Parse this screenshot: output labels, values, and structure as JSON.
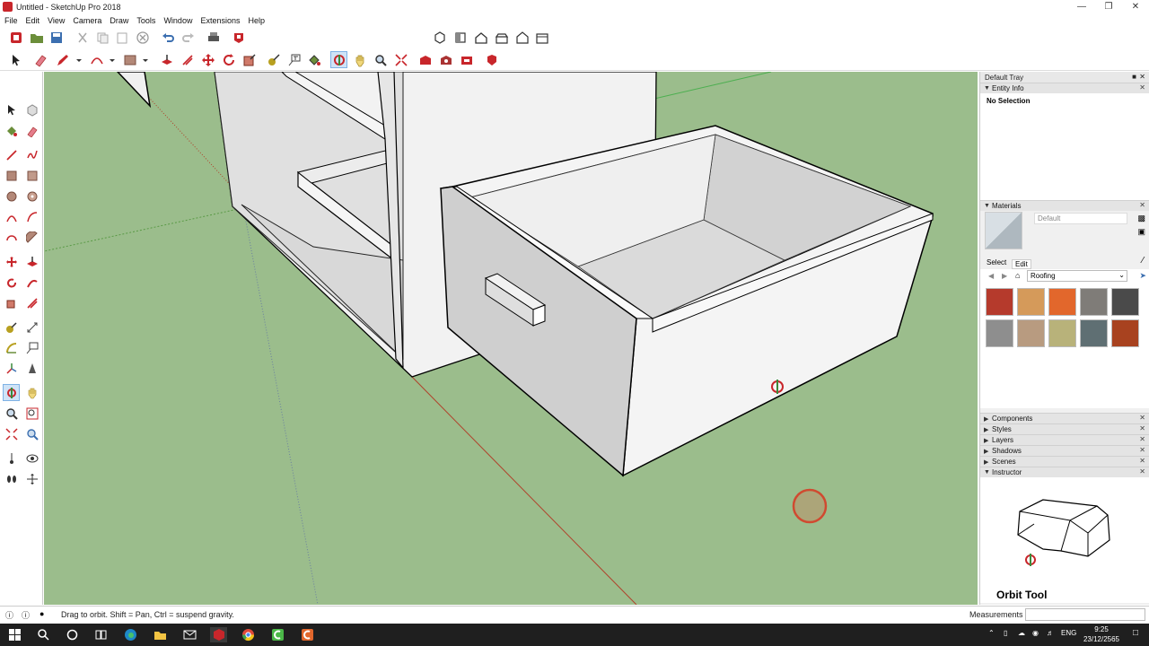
{
  "window": {
    "title": "Untitled - SketchUp Pro 2018"
  },
  "menu": [
    "File",
    "Edit",
    "View",
    "Camera",
    "Draw",
    "Tools",
    "Window",
    "Extensions",
    "Help"
  ],
  "tray": {
    "title": "Default Tray",
    "entity_info": {
      "label": "Entity Info",
      "selection": "No Selection"
    },
    "materials": {
      "label": "Materials",
      "current_name": "Default",
      "tab_select": "Select",
      "tab_edit": "Edit",
      "collection": "Roofing",
      "swatch_colors": [
        "#b53a2c",
        "#d59a5a",
        "#e2672c",
        "#7f7c78",
        "#4a4a4a",
        "#8e8e8e",
        "#b89b80",
        "#b8b27a",
        "#5f6f73",
        "#a8421f"
      ]
    },
    "panels": [
      "Components",
      "Styles",
      "Layers",
      "Shadows",
      "Scenes",
      "Instructor"
    ],
    "instructor_title": "Orbit Tool"
  },
  "status": {
    "text": "Drag to orbit. Shift = Pan, Ctrl = suspend gravity.",
    "measurements_label": "Measurements"
  },
  "taskbar": {
    "language": "ENG",
    "time": "9:25",
    "date": "23/12/2565"
  },
  "colors": {
    "ground": "#9bbd8c",
    "sketchup_red": "#c8262b",
    "active_tool": "#cfe3f7"
  }
}
